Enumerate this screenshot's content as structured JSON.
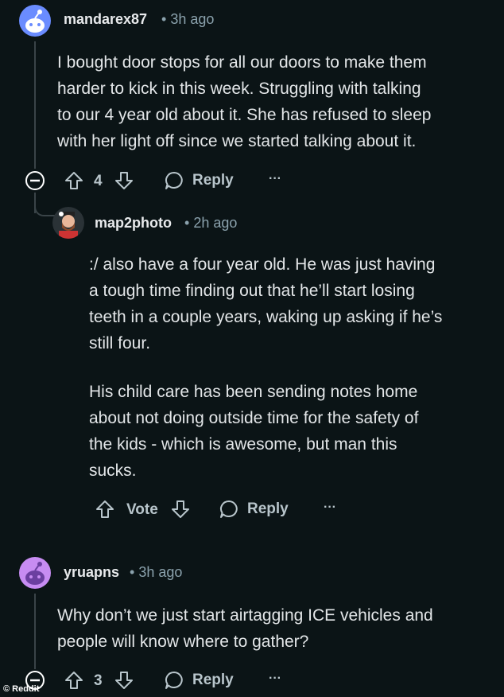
{
  "comments": [
    {
      "username": "mandarex87",
      "time": "3h ago",
      "avatar_color": "#6a8cff",
      "lines": [
        "I bought door stops for all our doors to make them",
        "harder to kick in this week. Struggling with talking",
        "to our 4 year old about it. She has refused to sleep",
        "with her light off since we started talking about it."
      ],
      "score": "4",
      "reply_label": "Reply",
      "more_label": "···"
    },
    {
      "username": "map2photo",
      "time": "2h ago",
      "paragraph1": [
        ":/ also have a four year old. He was just having",
        "a tough time finding out that he’ll start losing",
        "teeth in a couple years, waking up asking if he’s",
        "still four."
      ],
      "paragraph2": [
        "His child care has been sending notes home",
        "about not doing outside time for the safety of",
        "the kids - which is awesome, but man this",
        "sucks."
      ],
      "vote_label": "Vote",
      "reply_label": "Reply",
      "more_label": "···"
    },
    {
      "username": "yruapns",
      "time": "3h ago",
      "avatar_color": "#c78cf2",
      "lines": [
        "Why don’t we just start airtagging ICE vehicles and",
        "people will know where to gather?"
      ],
      "score": "3",
      "reply_label": "Reply",
      "more_label": "···"
    }
  ],
  "separator": "•",
  "watermark": "© Reddit"
}
